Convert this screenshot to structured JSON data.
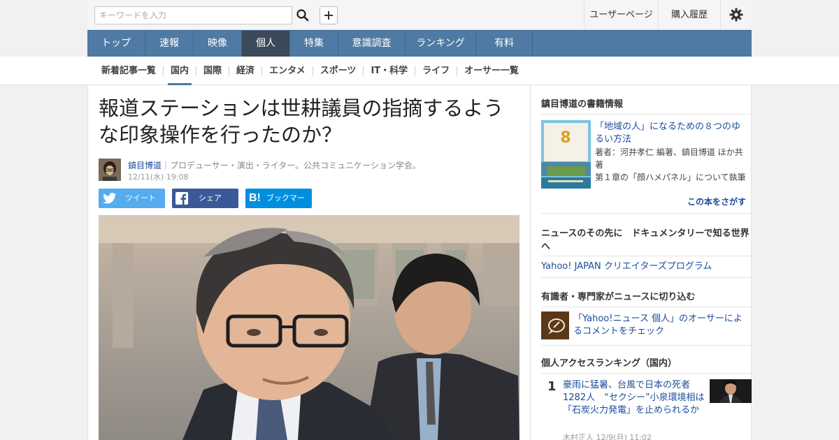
{
  "search": {
    "placeholder": "キーワードを入力"
  },
  "util": {
    "user_page": "ユーザーページ",
    "history": "購入履歴"
  },
  "mainnav": [
    "トップ",
    "速報",
    "映像",
    "個人",
    "特集",
    "意識調査",
    "ランキング",
    "有料"
  ],
  "mainnav_active": "個人",
  "subnav": [
    "新着記事一覧",
    "国内",
    "国際",
    "経済",
    "エンタメ",
    "スポーツ",
    "IT・科学",
    "ライフ",
    "オーサー一覧"
  ],
  "subnav_active": "国内",
  "article": {
    "title": "報道ステーションは世耕議員の指摘するような印象操作を行ったのか？",
    "author": "鎮目博道",
    "author_desc": "｜プロデューサー・演出・ライター。公共コミュニケーション学会。",
    "date": "12/11(水) 19:08",
    "share_tweet": "ツイート",
    "share_facebook": "シェア",
    "share_bookmark": "ブックマーク"
  },
  "sidebar": {
    "books_heading": "鎮目博道の書籍情報",
    "book_title": "「地域の人」になるための８つのゆるい方法",
    "book_author": "著者：河井孝仁 編著、鎮目博道 ほか共著",
    "book_note": "第１章の「顔ハメパネル」について執筆",
    "book_link": "この本をさがす",
    "doc_heading": "ニュースのその先に　ドキュメンタリーで知る世界へ",
    "doc_link": "Yahoo! JAPAN クリエイターズプログラム",
    "experts_heading": "有識者・専門家がニュースに切り込む",
    "experts_link": "「Yahoo!ニュース 個人」のオーサーによるコメントをチェック",
    "ranking_heading": "個人アクセスランキング（国内）",
    "rank_number": "1",
    "rank_title": "豪雨に猛暑、台風で日本の死者1282人　“セクシー”小泉環境相は「石炭火力発電」を止められるか",
    "rank_meta": "木村正人 12/9(月) 11:02"
  }
}
